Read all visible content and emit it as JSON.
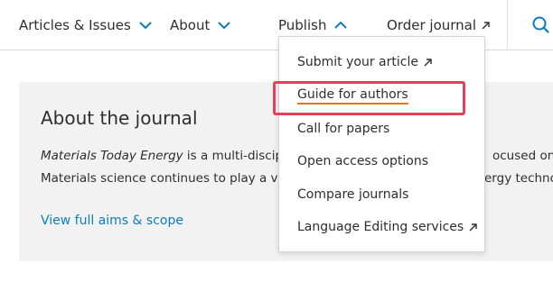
{
  "nav": {
    "articles_label": "Articles & Issues",
    "about_label": "About",
    "publish_label": "Publish",
    "order_label": "Order journal"
  },
  "about": {
    "title": "About the journal",
    "line1_italic": "Materials Today Energy",
    "line1_rest": " is a multi-discip",
    "line1_fragment": "ocused on a",
    "line2": "Materials science continues to play a vi",
    "line2_fragment": "ergy technol",
    "aims_link": "View full aims & scope"
  },
  "dropdown": {
    "items": [
      {
        "label": "Submit your article",
        "external": true
      },
      {
        "label": "Guide for authors",
        "external": false
      },
      {
        "label": "Call for papers",
        "external": false
      },
      {
        "label": "Open access options",
        "external": false
      },
      {
        "label": "Compare journals",
        "external": false
      },
      {
        "label": "Language Editing services",
        "external": true
      }
    ]
  },
  "colors": {
    "link_blue": "#0c7dbb",
    "accent_orange": "#e9711c",
    "highlight_red": "#e8405a"
  },
  "icons": {
    "chevron": "chevron-down-icon",
    "chevron_up": "chevron-up-icon",
    "external": "external-link-arrow-icon",
    "search": "search-icon"
  }
}
